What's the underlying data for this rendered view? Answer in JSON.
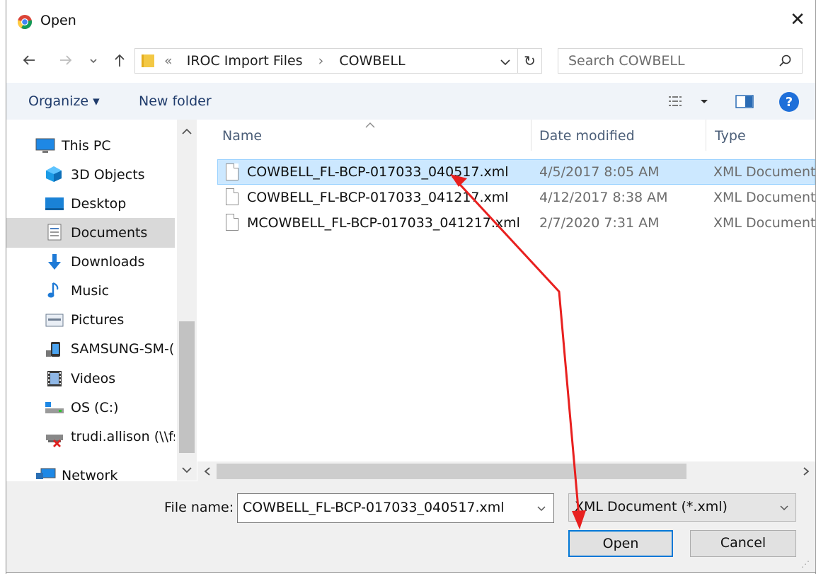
{
  "window": {
    "title": "Open",
    "close_icon": "close-icon",
    "app_icon": "chrome-icon"
  },
  "nav": {
    "back_icon": "back-arrow-icon",
    "forward_icon": "forward-arrow-icon",
    "recent_icon": "chevron-down-icon",
    "up_icon": "up-arrow-icon",
    "breadcrumb_overflow": "«",
    "breadcrumb": [
      "IROC Import Files",
      "COWBELL"
    ],
    "breadcrumb_separator": "›",
    "search_placeholder": "Search COWBELL"
  },
  "toolbar": {
    "organize_label": "Organize ▾",
    "new_folder_label": "New folder"
  },
  "sidebar": {
    "items": [
      {
        "label": "This PC",
        "icon": "this-pc-icon"
      },
      {
        "label": "3D Objects",
        "icon": "3d-objects-icon"
      },
      {
        "label": "Desktop",
        "icon": "desktop-icon"
      },
      {
        "label": "Documents",
        "icon": "documents-icon",
        "selected": true
      },
      {
        "label": "Downloads",
        "icon": "downloads-icon"
      },
      {
        "label": "Music",
        "icon": "music-icon"
      },
      {
        "label": "Pictures",
        "icon": "pictures-icon"
      },
      {
        "label": "SAMSUNG-SM-(",
        "icon": "phone-icon"
      },
      {
        "label": "Videos",
        "icon": "videos-icon"
      },
      {
        "label": "OS (C:)",
        "icon": "drive-icon"
      },
      {
        "label": "trudi.allison (\\\\fs",
        "icon": "network-drive-disconnected-icon"
      },
      {
        "label": "Network",
        "icon": "network-icon"
      }
    ]
  },
  "file_list": {
    "columns": [
      "Name",
      "Date modified",
      "Type"
    ],
    "rows": [
      {
        "name": "COWBELL_FL-BCP-017033_040517.xml",
        "date": "4/5/2017 8:05 AM",
        "type": "XML Document",
        "selected": true
      },
      {
        "name": "COWBELL_FL-BCP-017033_041217.xml",
        "date": "4/12/2017 8:38 AM",
        "type": "XML Document",
        "selected": false
      },
      {
        "name": "MCOWBELL_FL-BCP-017033_041217.xml",
        "date": "2/7/2020 7:31 AM",
        "type": "XML Document",
        "selected": false
      }
    ]
  },
  "footer": {
    "file_name_label": "File name:",
    "file_name_value": "COWBELL_FL-BCP-017033_040517.xml",
    "file_type_value": "XML Document (*.xml)",
    "open_label": "Open",
    "cancel_label": "Cancel"
  },
  "colors": {
    "selection": "#cce8ff",
    "accent": "#0078d7",
    "annotation_arrow": "#e8201f"
  }
}
